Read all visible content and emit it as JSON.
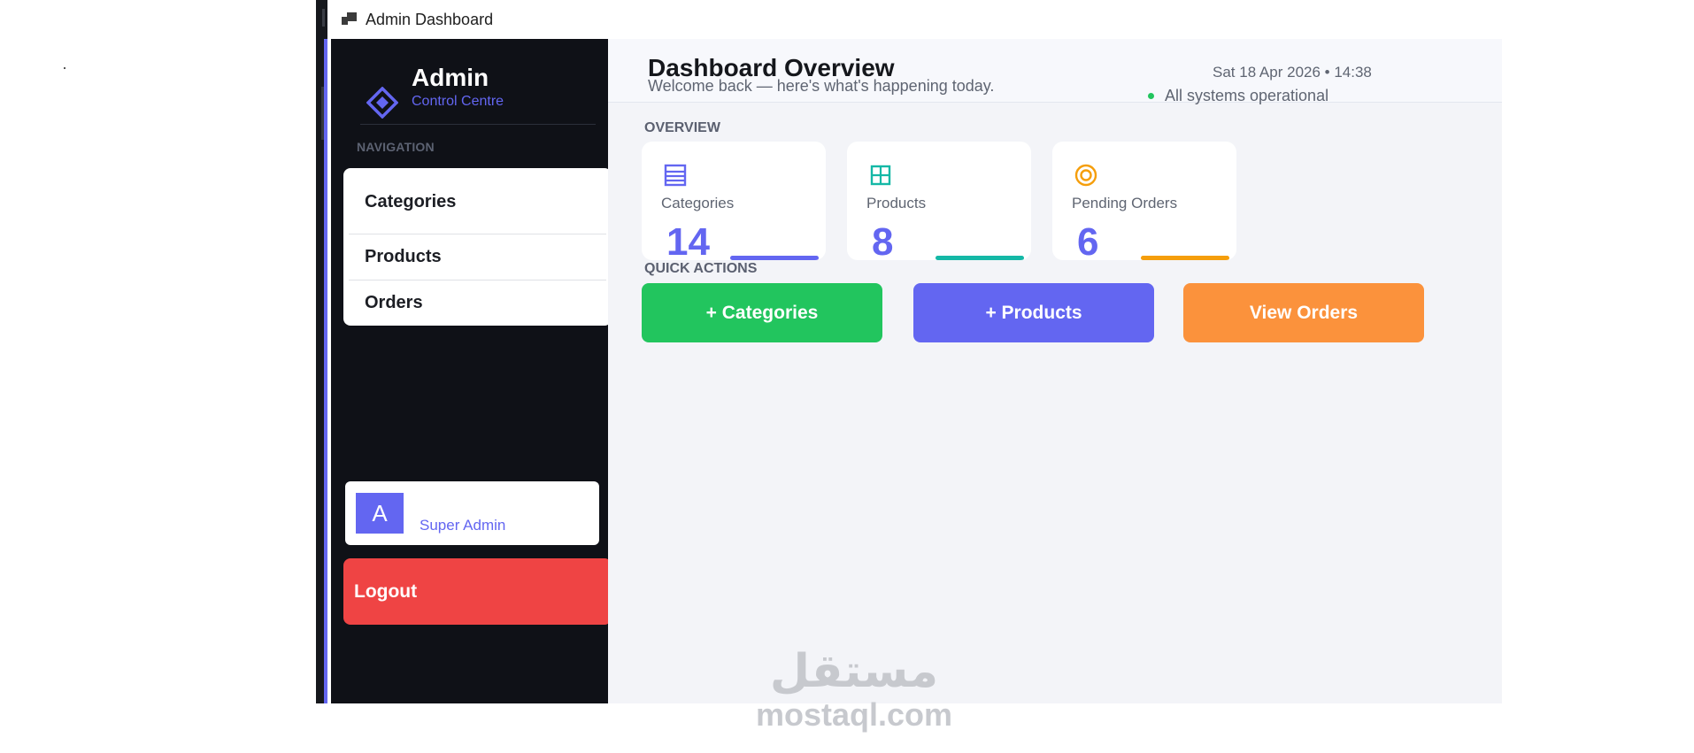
{
  "window": {
    "title": "Admin Dashboard"
  },
  "sidebar": {
    "brand_title": "Admin",
    "brand_subtitle": "Control Centre",
    "nav_heading": "NAVIGATION",
    "items": [
      {
        "label": "Categories"
      },
      {
        "label": "Products"
      },
      {
        "label": "Orders"
      }
    ],
    "user": {
      "avatar_letter": "A",
      "role": "Super Admin"
    },
    "logout_label": "Logout"
  },
  "header": {
    "title": "Dashboard Overview",
    "subtitle": "Welcome back — here's what's happening today.",
    "datetime": "Sat 18 Apr 2026  •  14:38",
    "status": "All systems operational"
  },
  "overview": {
    "label": "OVERVIEW",
    "cards": [
      {
        "label": "Categories",
        "value": "14",
        "icon": "list-icon",
        "accent": "#6366f1"
      },
      {
        "label": "Products",
        "value": "8",
        "icon": "grid-icon",
        "accent": "#14b8a6"
      },
      {
        "label": "Pending Orders",
        "value": "6",
        "icon": "target-icon",
        "accent": "#f59e0b"
      }
    ]
  },
  "quick_actions": {
    "label": "QUICK ACTIONS",
    "buttons": [
      {
        "label": "+ Categories",
        "color": "#22c55e"
      },
      {
        "label": "+ Products",
        "color": "#6366f1"
      },
      {
        "label": "View Orders",
        "color": "#fb923c"
      }
    ]
  },
  "watermark": {
    "arabic": "مستقل",
    "latin": "mostaql.com"
  }
}
